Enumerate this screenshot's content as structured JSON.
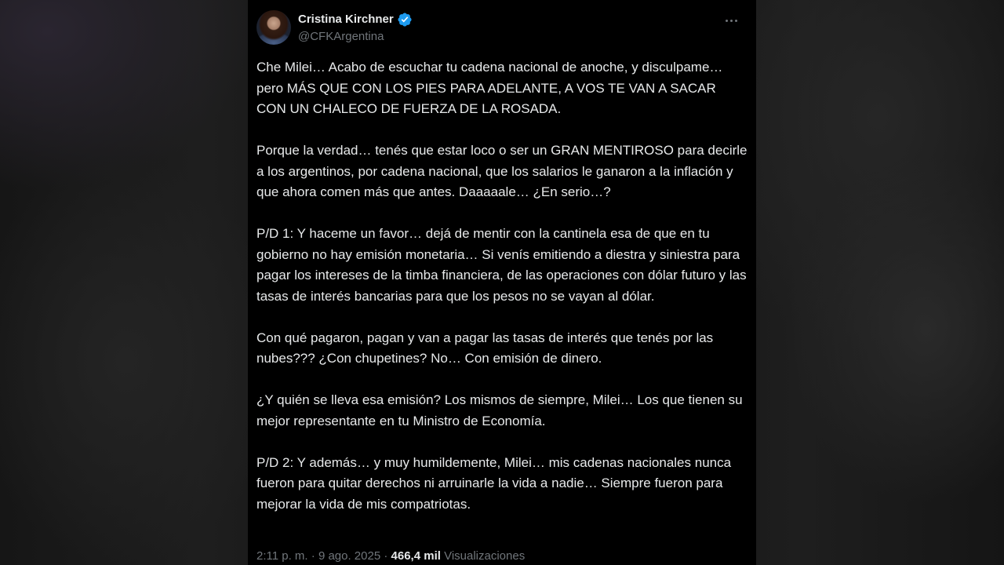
{
  "tweet": {
    "author_name": "Cristina Kirchner",
    "author_handle": "@CFKArgentina",
    "verified_color": "#1d9bf0",
    "paragraphs": [
      "Che Milei… Acabo de escuchar tu cadena nacional de anoche, y disculpame… pero MÁS QUE CON LOS PIES PARA ADELANTE, A VOS TE VAN A SACAR CON UN CHALECO DE FUERZA DE LA ROSADA.",
      "Porque la verdad… tenés que estar loco o ser un GRAN MENTIROSO para decirle a los argentinos, por cadena nacional, que los salarios le ganaron a la inflación y que ahora comen más que antes. Daaaaale… ¿En serio…?",
      "P/D 1: Y haceme un favor… dejá de mentir con la cantinela esa de que en tu gobierno no hay emisión monetaria… Si venís emitiendo a diestra y siniestra para pagar los intereses de la timba financiera, de las operaciones con dólar futuro y las tasas de interés bancarias para que los pesos no se vayan al dólar.",
      "Con qué pagaron, pagan y van a pagar las tasas de interés que tenés por las nubes??? ¿Con chupetines? No… Con emisión de dinero.",
      "¿Y quién se lleva esa emisión? Los mismos de siempre, Milei… Los que tienen su mejor representante en tu Ministro de Economía.",
      "P/D 2: Y además… y muy humildemente, Milei… mis cadenas nacionales nunca fueron para quitar derechos ni arruinarle la vida a nadie… Siempre fueron para mejorar la vida de mis compatriotas."
    ],
    "time": "2:11 p. m.",
    "separator": "·",
    "date": "9 ago. 2025",
    "views_count": "466,4 mil",
    "views_label": "Visualizaciones"
  },
  "icons": {
    "verified": "verified-badge-icon",
    "more": "more-horizontal-icon",
    "avatar": "profile-avatar"
  }
}
